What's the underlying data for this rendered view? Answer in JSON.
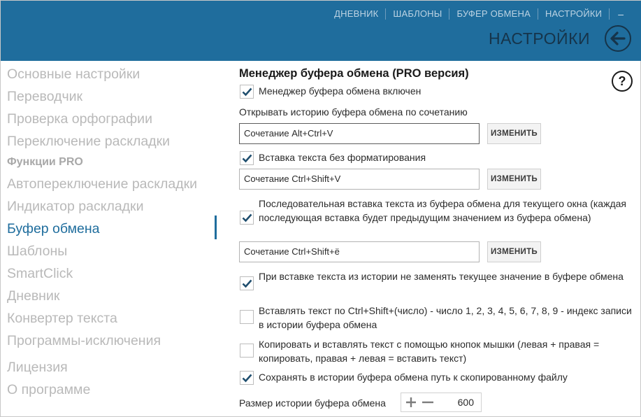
{
  "colors": {
    "accent": "#1f6d9d",
    "header_bg": "#1f6d9d",
    "title_text": "#16344a",
    "sidebar_inactive": "#b9b9b9"
  },
  "topnav": {
    "items": [
      "ДНЕВНИК",
      "ШАБЛОНЫ",
      "БУФЕР ОБМЕНА",
      "НАСТРОЙКИ"
    ],
    "minimize_label": "–"
  },
  "header": {
    "title": "НАСТРОЙКИ",
    "back_icon": "arrow-left-icon"
  },
  "sidebar": {
    "items": [
      {
        "label": "Основные настройки"
      },
      {
        "label": "Переводчик"
      },
      {
        "label": "Проверка орфографии"
      },
      {
        "label": "Переключение раскладки"
      },
      {
        "label": "Функции PRO"
      },
      {
        "label": "Автопереключение раскладки"
      },
      {
        "label": "Индикатор раскладки"
      },
      {
        "label": "Буфер обмена"
      },
      {
        "label": "Шаблоны"
      },
      {
        "label": "SmartClick"
      },
      {
        "label": "Дневник"
      },
      {
        "label": "Конвертер текста"
      },
      {
        "label": "Программы-исключения"
      },
      {
        "label": "Лицензия"
      },
      {
        "label": "О программе"
      }
    ],
    "active_index": 7
  },
  "main": {
    "section_title": "Менеджер буфера обмена  (PRO версия)",
    "help_label": "?",
    "options": [
      {
        "label": "Менеджер буфера обмена включен",
        "checked": true
      },
      {
        "label": "Вставка текста без форматирования",
        "checked": true
      },
      {
        "label": "Последовательная вставка текста из буфера обмена для текущего окна (каждая последующая вставка будет предыдущим значением из буфера обмена)",
        "checked": true
      },
      {
        "label": "При вставке текста из истории не заменять текущее значение в буфере обмена",
        "checked": true
      },
      {
        "label": "Вставлять текст по Ctrl+Shift+(число) - число 1, 2, 3, 4, 5, 6, 7, 8, 9 - индекс записи в истории буфера обмена",
        "checked": false
      },
      {
        "label": "Копировать и вставлять текст с помощью кнопок мышки (левая + правая = копировать, правая + левая = вставить текст)",
        "checked": false
      },
      {
        "label": "Сохранять в истории буфера обмена путь к скопированному файлу",
        "checked": true
      }
    ],
    "history_hotkey_label": "Открывать историю буфера обмена по сочетанию",
    "hotkeys": [
      {
        "value": "Сочетание Alt+Ctrl+V",
        "button": "ИЗМЕНИТЬ"
      },
      {
        "value": "Сочетание Ctrl+Shift+V",
        "button": "ИЗМЕНИТЬ"
      },
      {
        "value": "Сочетание Ctrl+Shift+ё",
        "button": "ИЗМЕНИТЬ"
      }
    ],
    "history_size": {
      "label": "Размер истории буфера обмена",
      "value": "600"
    }
  }
}
